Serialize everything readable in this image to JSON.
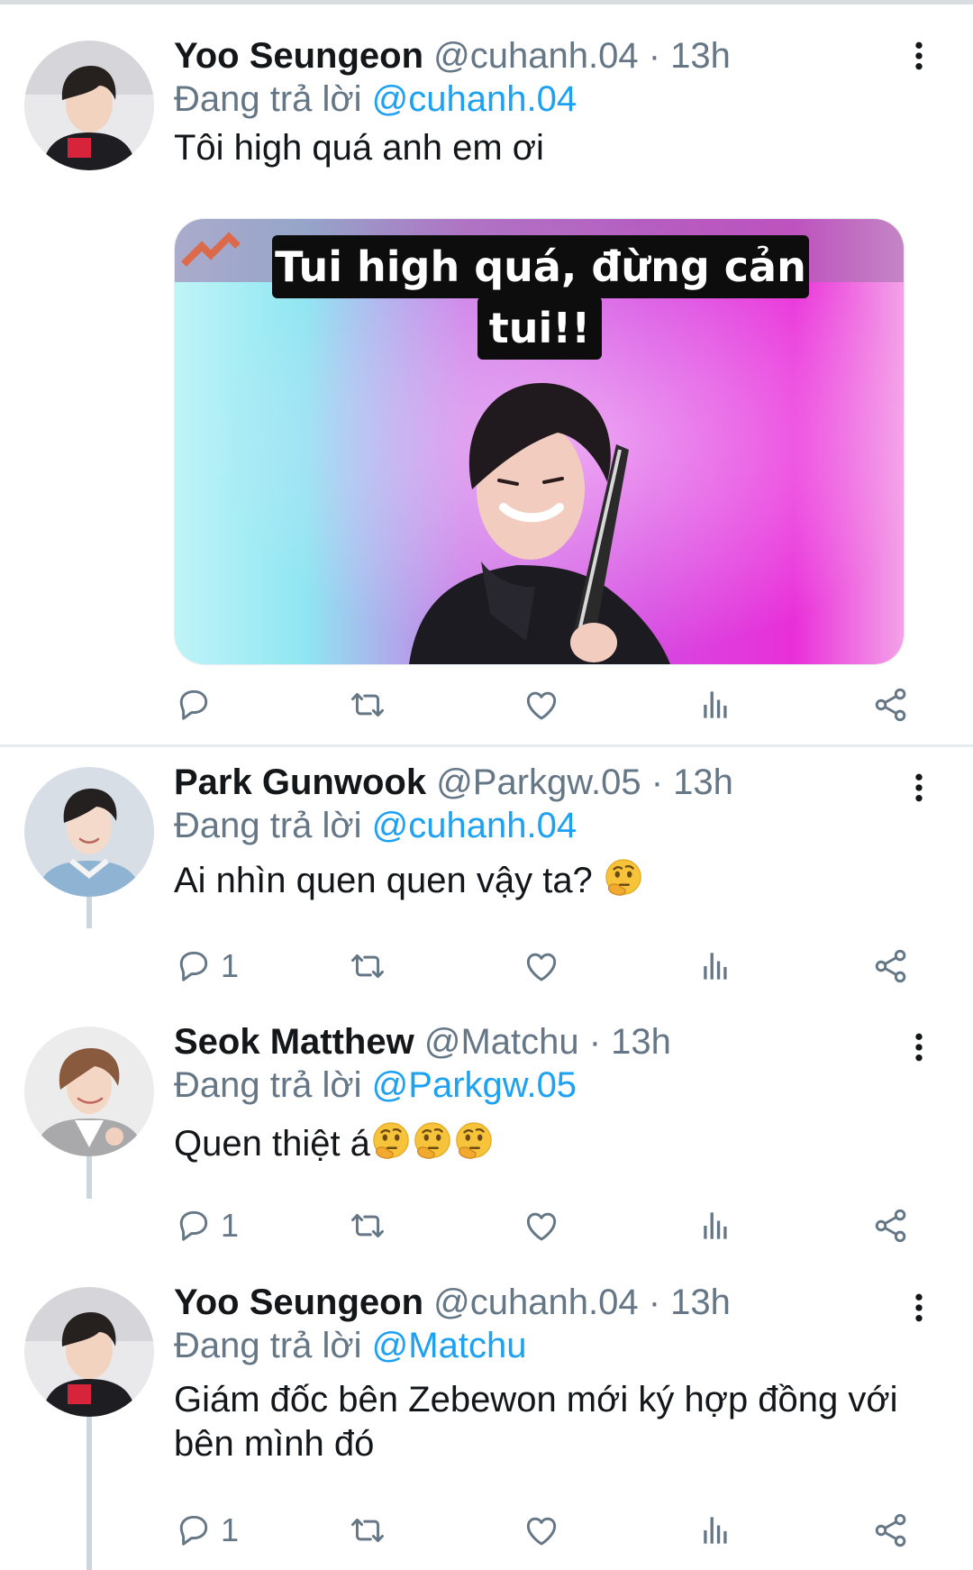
{
  "tweets": [
    {
      "name": "Yoo Seungeon",
      "handle": "@cuhanh.04",
      "time": "13h",
      "replying_prefix": "Đang trả lời",
      "replying_to": "@cuhanh.04",
      "text": "Tôi high quá anh em ơi",
      "media": {
        "caption_line1": "Tui high quá, đừng cản",
        "caption_line2": "tui!!"
      },
      "reply_count": ""
    },
    {
      "name": "Park Gunwook",
      "handle": "@Parkgw.05",
      "time": "13h",
      "replying_prefix": "Đang trả lời",
      "replying_to": "@cuhanh.04",
      "text": "Ai nhìn quen quen vậy ta?",
      "reply_count": "1"
    },
    {
      "name": "Seok Matthew",
      "handle": "@Matchu",
      "time": "13h",
      "replying_prefix": "Đang trả lời",
      "replying_to": "@Parkgw.05",
      "text": "Quen thiệt á",
      "reply_count": "1"
    },
    {
      "name": "Yoo Seungeon",
      "handle": "@cuhanh.04",
      "time": "13h",
      "replying_prefix": "Đang trả lời",
      "replying_to": "@Matchu",
      "text": "Giám đốc bên Zebewon mới ký hợp đồng với bên mình đó",
      "reply_count": "1"
    }
  ],
  "meta_separator": " · ",
  "icons": [
    "reply-icon",
    "retweet-icon",
    "like-icon",
    "analytics-icon",
    "share-icon",
    "more-options-icon",
    "thinking-face-emoji"
  ],
  "colors": {
    "link": "#1da1f2",
    "secondary": "#657786",
    "text": "#14171a",
    "thread_line": "#ccd6dd"
  }
}
